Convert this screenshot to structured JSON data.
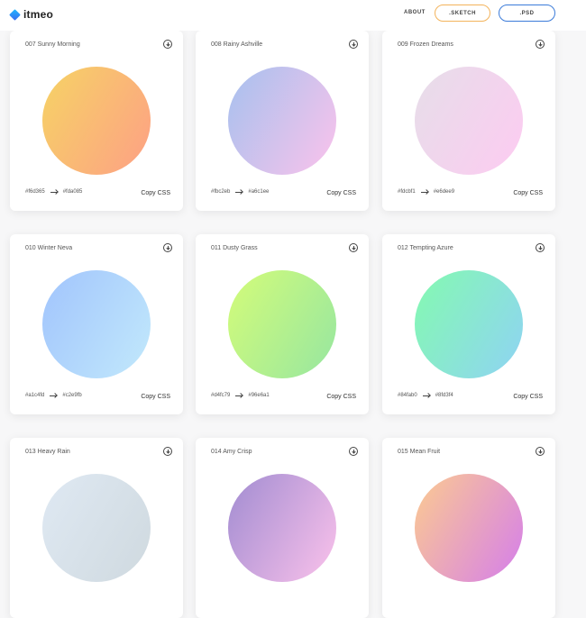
{
  "header": {
    "logo_text": "itmeo",
    "nav_about": "ABOUT",
    "sketch_label": ".SKETCH",
    "psd_label": ".PSD",
    "sketch_color": "#f3b35b",
    "psd_color": "#3b7bd9"
  },
  "copy_label": "Copy CSS",
  "cards": [
    {
      "title": "007 Sunny Morning",
      "from": "#f6d365",
      "to": "#fda085"
    },
    {
      "title": "008 Rainy Ashville",
      "from": "#fbc2eb",
      "to": "#a6c1ee"
    },
    {
      "title": "009 Frozen Dreams",
      "from": "#fdcbf1",
      "to": "#e6dee9"
    },
    {
      "title": "010 Winter Neva",
      "from": "#a1c4fd",
      "to": "#c2e9fb"
    },
    {
      "title": "011 Dusty Grass",
      "from": "#d4fc79",
      "to": "#96e6a1"
    },
    {
      "title": "012 Tempting Azure",
      "from": "#84fab0",
      "to": "#8fd3f4"
    },
    {
      "title": "013 Heavy Rain",
      "from": "",
      "to": ""
    },
    {
      "title": "014 Amy Crisp",
      "from": "",
      "to": ""
    },
    {
      "title": "015 Mean Fruit",
      "from": "",
      "to": ""
    }
  ],
  "gradient_colors": [
    [
      "#f6d365",
      "#fda085"
    ],
    [
      "#a6c1ee",
      "#fbc2eb"
    ],
    [
      "#e6dee9",
      "#fdcbf1"
    ],
    [
      "#a1c4fd",
      "#c2e9fb"
    ],
    [
      "#d4fc79",
      "#96e6a1"
    ],
    [
      "#84fab0",
      "#8fd3f4"
    ],
    [
      "#dfe9f3",
      "#cfd9df"
    ],
    [
      "#a18cd1",
      "#fbc2eb"
    ],
    [
      "#fccb90",
      "#d57eeb"
    ]
  ]
}
